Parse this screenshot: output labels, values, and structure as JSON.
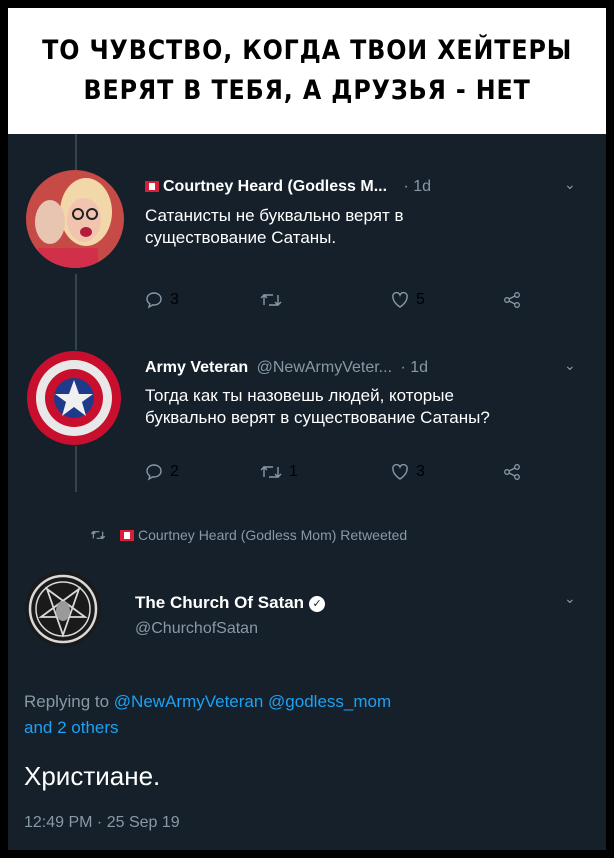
{
  "caption": {
    "line1": "ТО ЧУВСТВО, КОГДА ТВОИ ХЕЙТЕРЫ",
    "line2": "ВЕРЯТ В ТЕБЯ, А ДРУЗЬЯ - НЕТ"
  },
  "tweets": [
    {
      "name": "Courtney Heard (Godless M...",
      "time": "· 1d",
      "text_line1": "Сатанисты не буквально верят в",
      "text_line2": "существование Сатаны.",
      "replies": "3",
      "retweets": "",
      "likes": "5"
    },
    {
      "name": "Army Veteran",
      "handle": "@NewArmyVeter...",
      "time": "· 1d",
      "text_line1": "Тогда как ты назовешь людей, которые",
      "text_line2": "буквально верят в существование Сатаны?",
      "replies": "2",
      "retweets": "1",
      "likes": "3"
    }
  ],
  "retweet_note": "Courtney Heard (Godless Mom) Retweeted",
  "main_tweet": {
    "name": "The Church Of Satan",
    "handle": "@ChurchofSatan",
    "replying_prefix": "Replying to",
    "replying_mentions": "@NewArmyVeteran @godless_mom",
    "replying_others": "and 2 others",
    "text": "Христиане.",
    "timestamp": "12:49 PM · 25 Sep 19"
  },
  "colors": {
    "background": "#15202b",
    "secondary_text": "#8899a6",
    "link": "#1da1f2",
    "thread_line": "#38444d"
  }
}
